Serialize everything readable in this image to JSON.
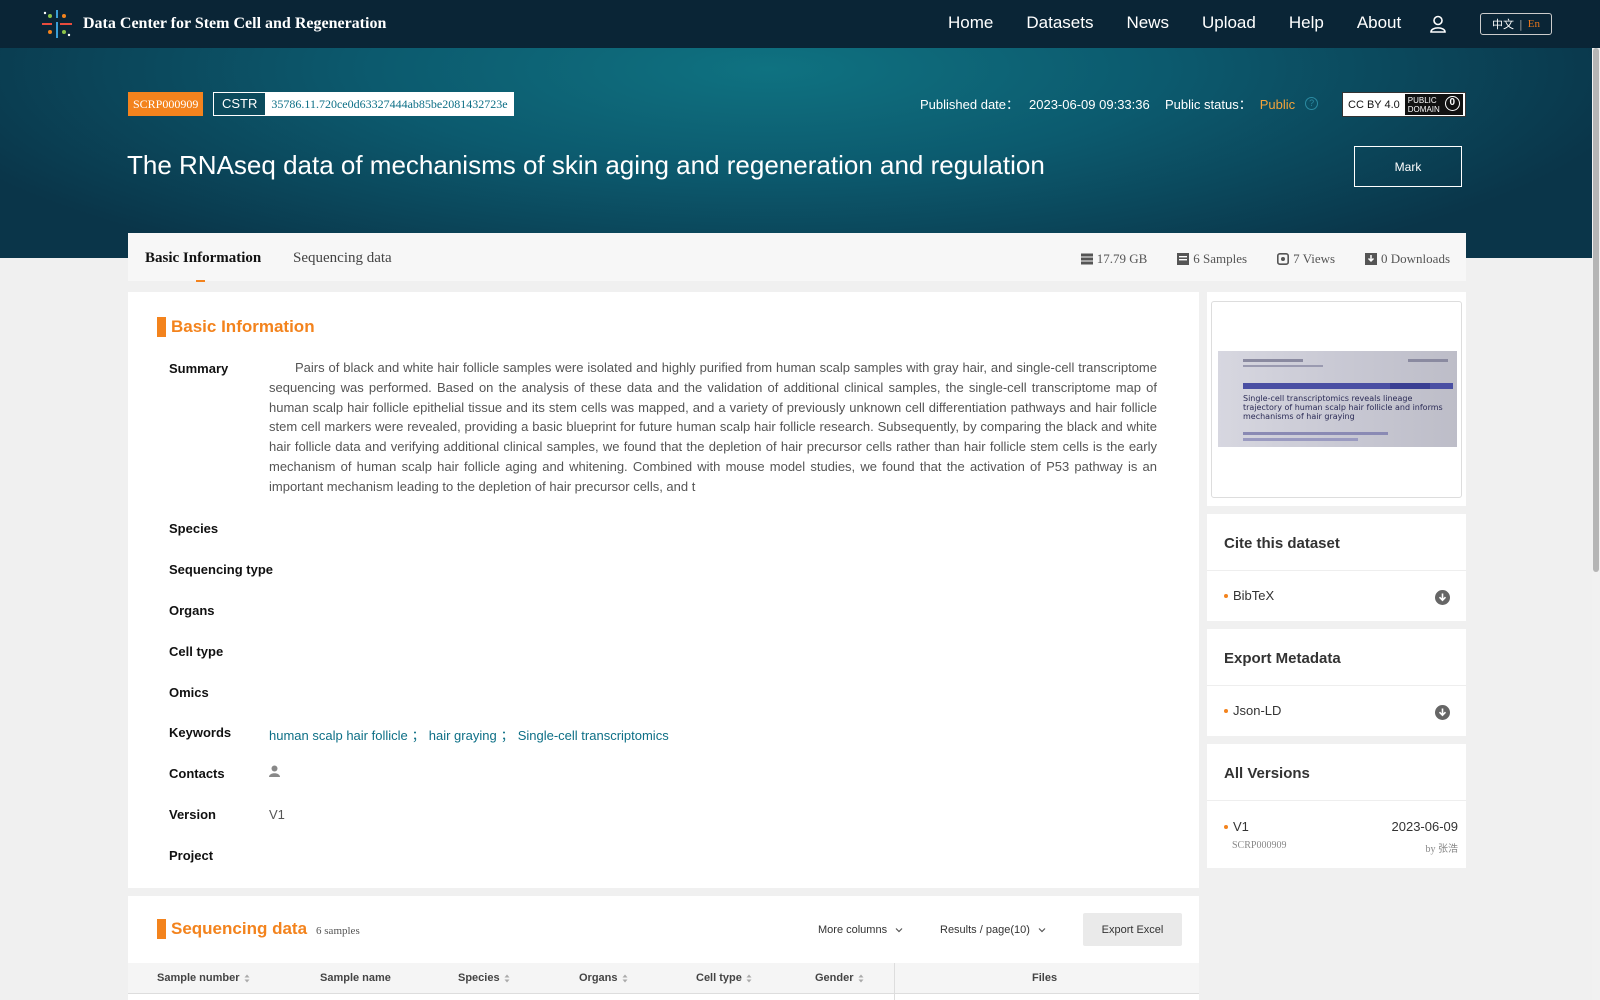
{
  "nav": {
    "brand": "Data Center for Stem Cell and Regeneration",
    "links": [
      "Home",
      "Datasets",
      "News",
      "Upload",
      "Help",
      "About"
    ],
    "lang_zh": "中文",
    "lang_sep": "|",
    "lang_en": "En"
  },
  "hero": {
    "id": "SCRP000909",
    "cstr_label": "CSTR",
    "cstr_value": "35786.11.720ce0d63327444ab85be2081432723e",
    "published_label": "Published date：",
    "published_value": "2023-06-09 09:33:36",
    "status_label": "Public status：",
    "status_value": "Public",
    "license_text": "CC BY 4.0",
    "license_badge_1": "PUBLIC",
    "license_badge_2": "DOMAIN",
    "title": "The RNAseq data of mechanisms of skin aging and regeneration and regulation",
    "mark_label": "Mark"
  },
  "tabs": {
    "basic": "Basic Information",
    "sequencing": "Sequencing data"
  },
  "stats": {
    "size": "17.79 GB",
    "samples": "6 Samples",
    "views": "7 Views",
    "downloads": "0 Downloads"
  },
  "basic": {
    "section_title": "Basic Information",
    "labels": {
      "summary": "Summary",
      "species": "Species",
      "sequencing_type": "Sequencing type",
      "organs": "Organs",
      "cell_type": "Cell type",
      "omics": "Omics",
      "keywords": "Keywords",
      "contacts": "Contacts",
      "version": "Version",
      "project": "Project"
    },
    "summary": "Pairs of black and white hair follicle samples were isolated and highly purified from human scalp samples with gray hair, and single-cell transcriptome sequencing was performed. Based on the analysis of these data and the validation of additional clinical samples, the single-cell transcriptome map of human scalp hair follicle epithelial tissue and its stem cells was mapped, and a variety of previously unknown cell differentiation pathways and hair follicle stem cell markers were revealed, providing a basic blueprint for future human scalp hair follicle research. Subsequently, by comparing the black and white hair follicle data and verifying additional clinical samples, we found that the depletion of hair precursor cells rather than hair follicle stem cells is the early mechanism of human scalp hair follicle aging and whitening. Combined with mouse model studies, we found that the activation of P53 pathway is an important mechanism leading to the depletion of hair precursor cells, and t",
    "keywords": [
      "human scalp hair follicle",
      "hair graying",
      "Single-cell transcriptomics"
    ],
    "keyword_sep": "；",
    "version": "V1"
  },
  "sidebar": {
    "paper_title": "Single-cell transcriptomics reveals lineage trajectory of human scalp hair follicle and informs mechanisms of hair graying",
    "cite_title": "Cite this dataset",
    "cite_item": "BibTeX",
    "meta_title": "Export Metadata",
    "meta_item": "Json-LD",
    "versions_title": "All Versions",
    "version_name": "V1",
    "version_date": "2023-06-09",
    "version_id": "SCRP000909",
    "version_by": "by 张浩"
  },
  "sequencing": {
    "section_title": "Sequencing data",
    "count": "6 samples",
    "more_columns": "More columns",
    "per_page": "Results / page(10)",
    "export": "Export Excel",
    "columns": [
      "Sample number",
      "Sample name",
      "Species",
      "Organs",
      "Cell type",
      "Gender",
      "Files"
    ]
  },
  "colors": {
    "accent": "#f3831d",
    "nav_bg": "#0a2536",
    "link": "#0d6f86"
  }
}
